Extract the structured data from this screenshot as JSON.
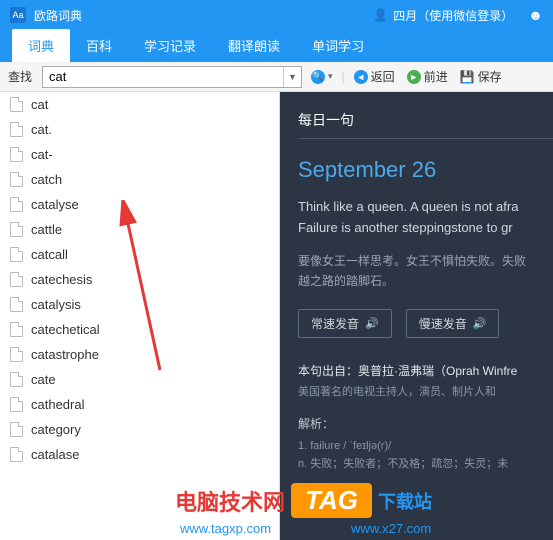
{
  "titlebar": {
    "app_name": "欧路词典",
    "user_name": "四月",
    "login_info": "（使用微信登录）"
  },
  "tabs": [
    {
      "label": "词典",
      "active": true
    },
    {
      "label": "百科",
      "active": false
    },
    {
      "label": "学习记录",
      "active": false
    },
    {
      "label": "翻译朗读",
      "active": false
    },
    {
      "label": "单词学习",
      "active": false
    }
  ],
  "toolbar": {
    "search_label": "查找",
    "search_value": "cat",
    "back_label": "返回",
    "forward_label": "前进",
    "save_label": "保存"
  },
  "suggestions": [
    "cat",
    "cat.",
    "cat-",
    "catch",
    "catalyse",
    "cattle",
    "catcall",
    "catechesis",
    "catalysis",
    "catechetical",
    "catastrophe",
    "cate",
    "cathedral",
    "category",
    "catalase"
  ],
  "content": {
    "section_title": "每日一句",
    "date": "September 26",
    "quote_en_line1": "Think like a queen. A queen is not afra",
    "quote_en_line2": "Failure is another steppingstone to gr",
    "quote_zh_line1": "要像女王一样思考。女王不惧怕失败。失败",
    "quote_zh_line2": "越之路的踏脚石。",
    "audio_normal": "常速发音",
    "audio_slow": "慢速发音",
    "source_label": "本句出自：奥普拉·温弗瑞（Oprah Winfre",
    "source_desc": "美国著名的电视主持人，演员、制片人和",
    "analysis_label": "解析：",
    "analysis_line1": "1. failure / ˈfeɪljə(r)/",
    "analysis_line2": "n. 失败；失败者；不及格；疏忽；失灵；未"
  },
  "watermark": {
    "text1": "电脑技术网",
    "tag": "TAG",
    "url1": "www.tagxp.com",
    "text2": "下载站",
    "url2": "www.x27.com"
  }
}
